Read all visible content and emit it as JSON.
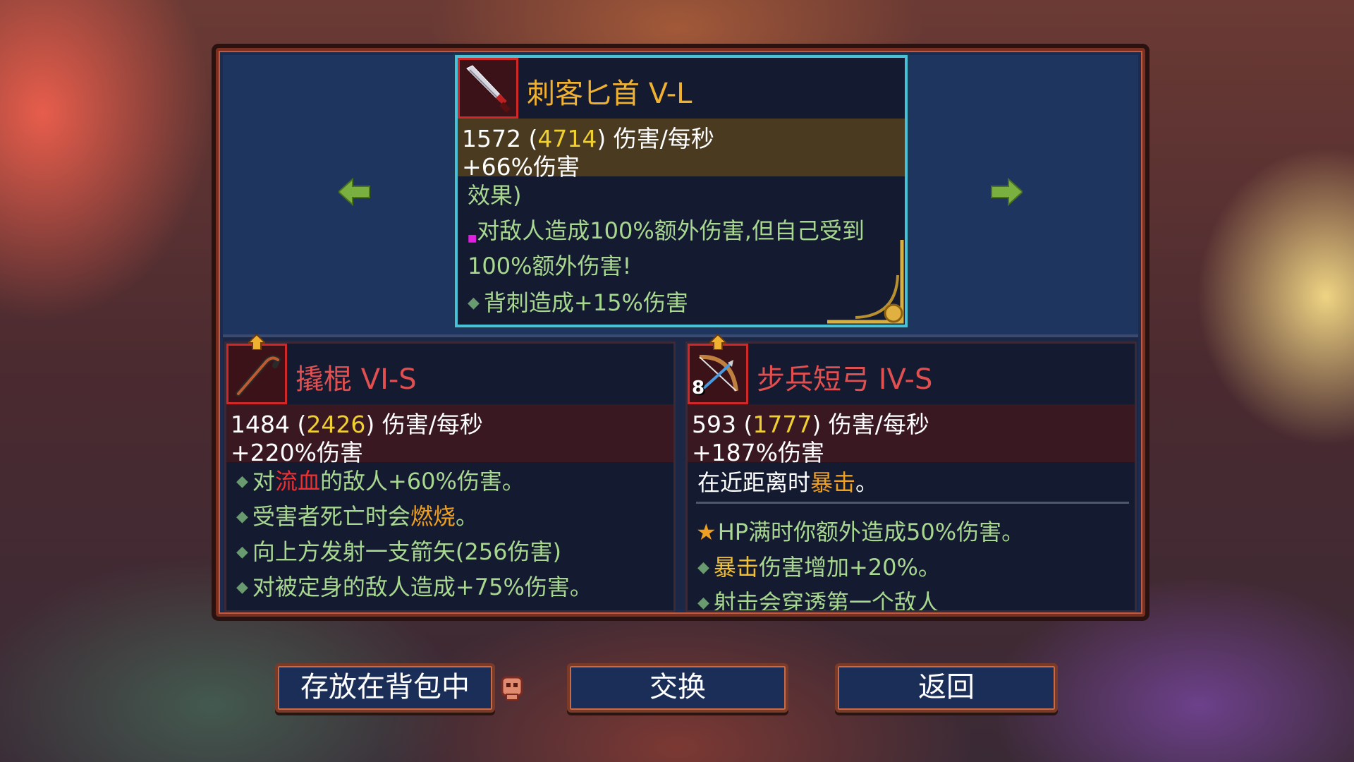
{
  "main_item": {
    "name": "刺客匕首 V-L",
    "dps_base": "1572",
    "dps_max": "4714",
    "dps_unit": "伤害/每秒",
    "bonus": "+66%伤害",
    "effect_header": "效果)",
    "effects": [
      "对敌人造成100%额外伤害,但自己受到",
      "100%额外伤害!",
      "背刺造成+15%伤害"
    ],
    "icon": "dagger-icon"
  },
  "left_item": {
    "name": "撬棍 VI-S",
    "dps_base": "1484",
    "dps_max": "2426",
    "dps_unit": "伤害/每秒",
    "bonus": "+220%伤害",
    "effects": [
      {
        "pre": "对",
        "hl": "流血",
        "post": "的敌人+60%伤害。"
      },
      {
        "pre": "受害者死亡时会",
        "hl": "燃烧",
        "post": "。"
      },
      {
        "pre": "向上方发射一支箭矢(256伤害)",
        "hl": "",
        "post": ""
      },
      {
        "pre": "对被定身的敌人造成+75%伤害。",
        "hl": "",
        "post": ""
      }
    ],
    "icon": "crowbar-icon"
  },
  "right_item": {
    "name": "步兵短弓 IV-S",
    "dps_base": "593",
    "dps_max": "1777",
    "dps_unit": "伤害/每秒",
    "bonus": "+187%伤害",
    "main_effect": {
      "pre": "在近距离时",
      "hl": "暴击",
      "post": "。"
    },
    "effects": [
      {
        "pre": "HP满时你额外造成50%伤害。",
        "hl": "",
        "post": ""
      },
      {
        "pre": "",
        "hl": "暴击",
        "post": "伤害增加+20%。"
      },
      {
        "pre": "射击会穿透第一个敌人",
        "hl": "",
        "post": ""
      }
    ],
    "ammo": "8",
    "icon": "bow-icon"
  },
  "buttons": {
    "store": "存放在背包中",
    "swap": "交换",
    "back": "返回"
  },
  "colors": {
    "main_border": "#4ac0d8",
    "title_gold": "#f0b030",
    "title_red": "#e05050",
    "highlight_yellow": "#f0d030"
  }
}
